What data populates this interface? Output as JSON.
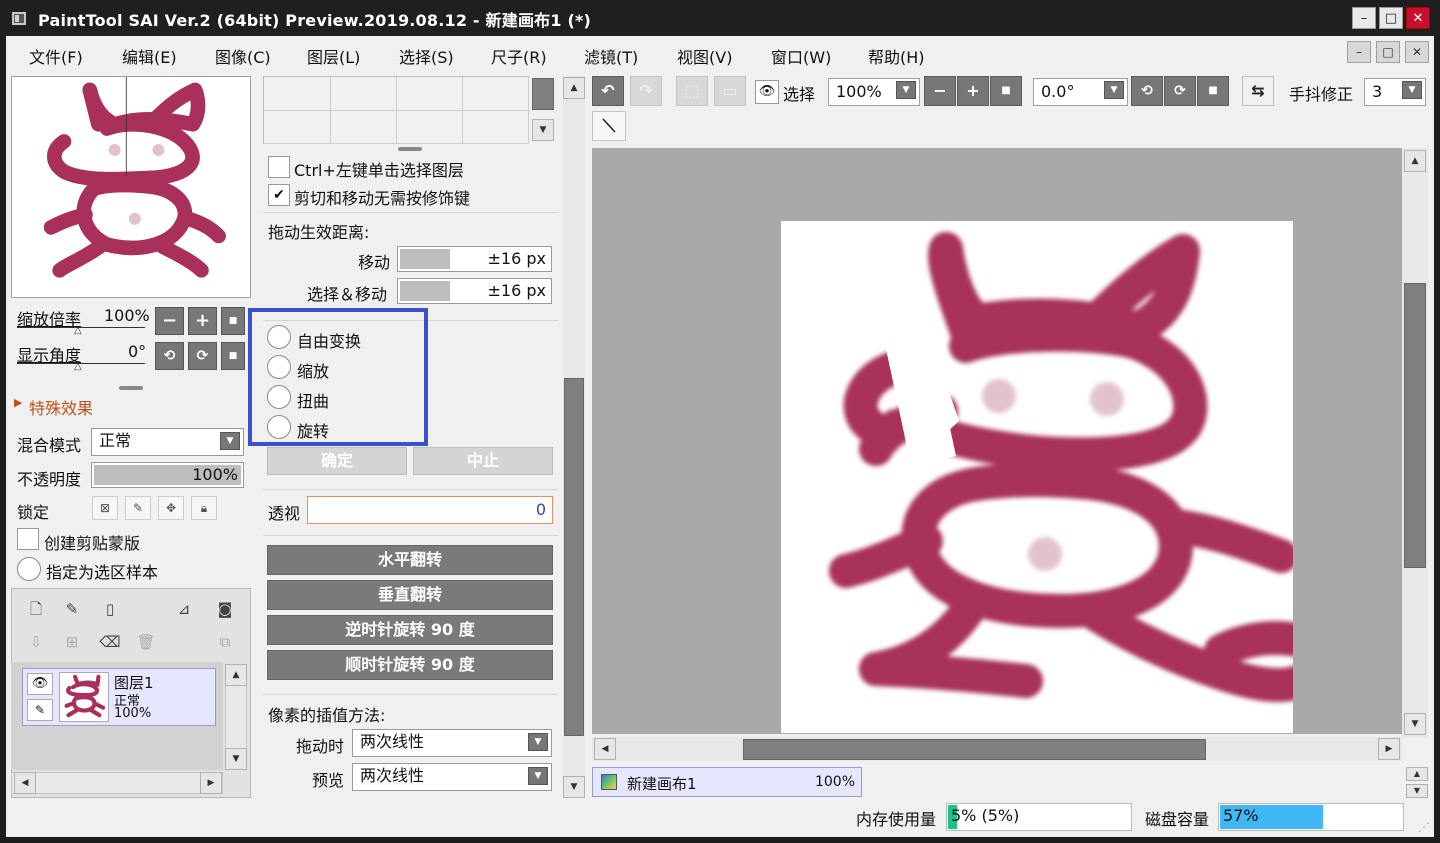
{
  "window": {
    "title": "PaintTool SAI Ver.2 (64bit) Preview.2019.08.12 - 新建画布1 (*)",
    "min": "–",
    "max": "□",
    "close": "✕"
  },
  "menu": [
    "文件(F)",
    "编辑(E)",
    "图像(C)",
    "图层(L)",
    "选择(S)",
    "尺子(R)",
    "滤镜(T)",
    "视图(V)",
    "窗口(W)",
    "帮助(H)"
  ],
  "navigator": {
    "zoom_label": "缩放倍率",
    "zoom_value": "100%",
    "angle_label": "显示角度",
    "angle_value": "0°"
  },
  "effects": {
    "label": "特殊效果"
  },
  "layer_props": {
    "blend_label": "混合模式",
    "blend_value": "正常",
    "opacity_label": "不透明度",
    "opacity_value": "100%",
    "opacity_fraction": 1.0,
    "lock_label": "锁定",
    "clip_label": "创建剪贴蒙版",
    "sample_label": "指定为选区样本"
  },
  "layer": {
    "name": "图层1",
    "mode": "正常",
    "opacity": "100%"
  },
  "tool_options": {
    "ctrl_click_label": "Ctrl+左键单击选择图层",
    "ctrl_click_checked": false,
    "cut_move_label": "剪切和移动无需按修饰键",
    "cut_move_checked": true,
    "drag_distance_label": "拖动生效距离:",
    "move_label": "移动",
    "move_value": "±16 px",
    "select_move_label": "选择＆移动",
    "select_move_value": "±16 px",
    "transform_options": [
      "自由变换",
      "缩放",
      "扭曲",
      "旋转"
    ],
    "ok_label": "确定",
    "cancel_label": "中止",
    "perspective_label": "透视",
    "perspective_value": "0",
    "flip_h_label": "水平翻转",
    "flip_v_label": "垂直翻转",
    "rotate_ccw_label": "逆时针旋转 90 度",
    "rotate_cw_label": "顺时针旋转 90 度",
    "interp_label": "像素的插值方法:",
    "drag_interp_label": "拖动时",
    "drag_interp_value": "两次线性",
    "preview_label": "预览",
    "preview_value": "两次线性"
  },
  "canvas_toolbar": {
    "select_label": "选择",
    "zoom_value": "100%",
    "angle_value": "0.0°",
    "stabilizer_label": "手抖修正",
    "stabilizer_value": "3"
  },
  "canvas_tab": {
    "name": "新建画布1",
    "zoom": "100%"
  },
  "status": {
    "memory_label": "内存使用量",
    "memory_value": "5% (5%)",
    "memory_fraction": 0.05,
    "disk_label": "磁盘容量",
    "disk_value": "57%",
    "disk_fraction": 0.57
  },
  "colors": {
    "stroke": "#a8305a",
    "highlight_box": "#3a4fc8",
    "meter_memory": "#1ec08a",
    "meter_disk": "#3fb8f5"
  }
}
